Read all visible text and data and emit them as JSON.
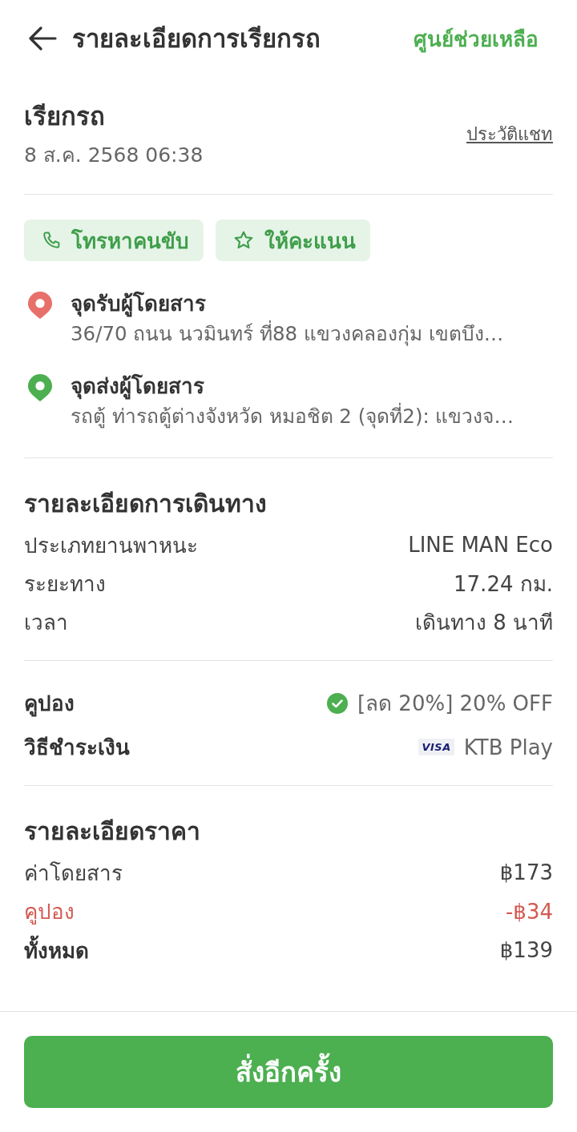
{
  "header": {
    "title": "รายละเอียดการเรียกรถ",
    "help_link": "ศูนย์ช่วยเหลือ"
  },
  "order": {
    "title": "เรียกรถ",
    "datetime": "8 ส.ค. 2568 06:38",
    "chat_history_link": "ประวัติแชท"
  },
  "actions": [
    {
      "kind": "call",
      "label": "โทรหาคนขับ"
    },
    {
      "kind": "rate",
      "label": "ให้คะแนน"
    }
  ],
  "locations": [
    {
      "color": "#e8706a",
      "title": "จุดรับผู้โดยสาร",
      "address": "36/70 ถนน นวมินทร์ ที่88 แขวงคลองกุ่ม เขตบึง…"
    },
    {
      "color": "#4caf50",
      "title": "จุดส่งผู้โดยสาร",
      "address": "รถตู้ ท่ารถตู้ต่างจังหวัด หมอชิต 2 (จุดที่2): แขวงจ…"
    }
  ],
  "trip": {
    "title": "รายละเอียดการเดินทาง",
    "rows": [
      {
        "label": "ประเภทยานพาหนะ",
        "value": "LINE MAN Eco"
      },
      {
        "label": "ระยะทาง",
        "value": "17.24 กม."
      },
      {
        "label": "เวลา",
        "value": "เดินทาง 8 นาที"
      }
    ]
  },
  "payment": {
    "rows": [
      {
        "kind": "coupon",
        "label": "คูปอง",
        "value": "[ลด 20%] 20% OFF"
      },
      {
        "kind": "method",
        "label": "วิธีชำระเงิน",
        "card_brand": "VISA",
        "value": "KTB Play"
      }
    ]
  },
  "price": {
    "title": "รายละเอียดราคา",
    "rows": [
      {
        "kind": "normal",
        "label": "ค่าโดยสาร",
        "value": "฿173"
      },
      {
        "kind": "discount",
        "label": "คูปอง",
        "value": "-฿34"
      },
      {
        "kind": "total",
        "label": "ทั้งหมด",
        "value": "฿139"
      }
    ]
  },
  "reorder_button": {
    "label": "สั่งอีกครั้ง"
  }
}
